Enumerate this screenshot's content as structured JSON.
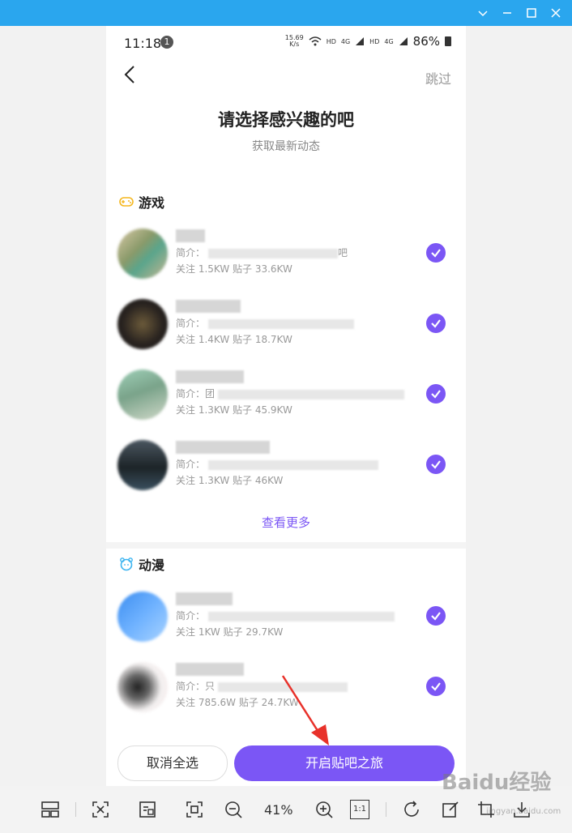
{
  "window": {
    "controls": [
      "minimize",
      "restore",
      "maximize",
      "close"
    ]
  },
  "status_bar": {
    "time": "11:18",
    "notification_count": "1",
    "net_speed_top": "15.69",
    "net_speed_unit": "K/s",
    "hd1": "HD",
    "sig1": "4G",
    "hd2": "HD",
    "sig2": "4G",
    "battery": "86%"
  },
  "header": {
    "skip_label": "跳过",
    "title": "请选择感兴趣的吧",
    "subtitle": "获取最新动态"
  },
  "sections": [
    {
      "title": "游戏",
      "icon": "gamepad-icon",
      "items": [
        {
          "intro_prefix": "简介：",
          "intro_suffix": "吧",
          "stats": "关注 1.5KW    贴子 33.6KW"
        },
        {
          "intro_prefix": "简介：",
          "intro_suffix": "",
          "stats": "关注 1.4KW    贴子 18.7KW"
        },
        {
          "intro_prefix": "简介：团",
          "intro_suffix": "",
          "stats": "关注 1.3KW    贴子 45.9KW"
        },
        {
          "intro_prefix": "简介：",
          "intro_suffix": "",
          "stats": "关注 1.3KW    贴子 46KW"
        }
      ],
      "more_label": "查看更多"
    },
    {
      "title": "动漫",
      "icon": "bear-face-icon",
      "items": [
        {
          "intro_prefix": "简介：",
          "intro_suffix": "",
          "stats": "关注 1KW    贴子 29.7KW"
        },
        {
          "intro_prefix": "简介：只",
          "intro_suffix": "",
          "stats": "关注 785.6W    贴子 24.7KW"
        }
      ]
    }
  ],
  "footer": {
    "cancel_label": "取消全选",
    "start_label": "开启贴吧之旅"
  },
  "viewer_toolbar": {
    "zoom": "41%",
    "one_to_one": "1:1"
  },
  "watermark": {
    "text": "Baidu经验",
    "sub": "jingyan.baidu.com"
  },
  "colors": {
    "accent": "#7b56f5",
    "titlebar": "#2aa6ee"
  }
}
